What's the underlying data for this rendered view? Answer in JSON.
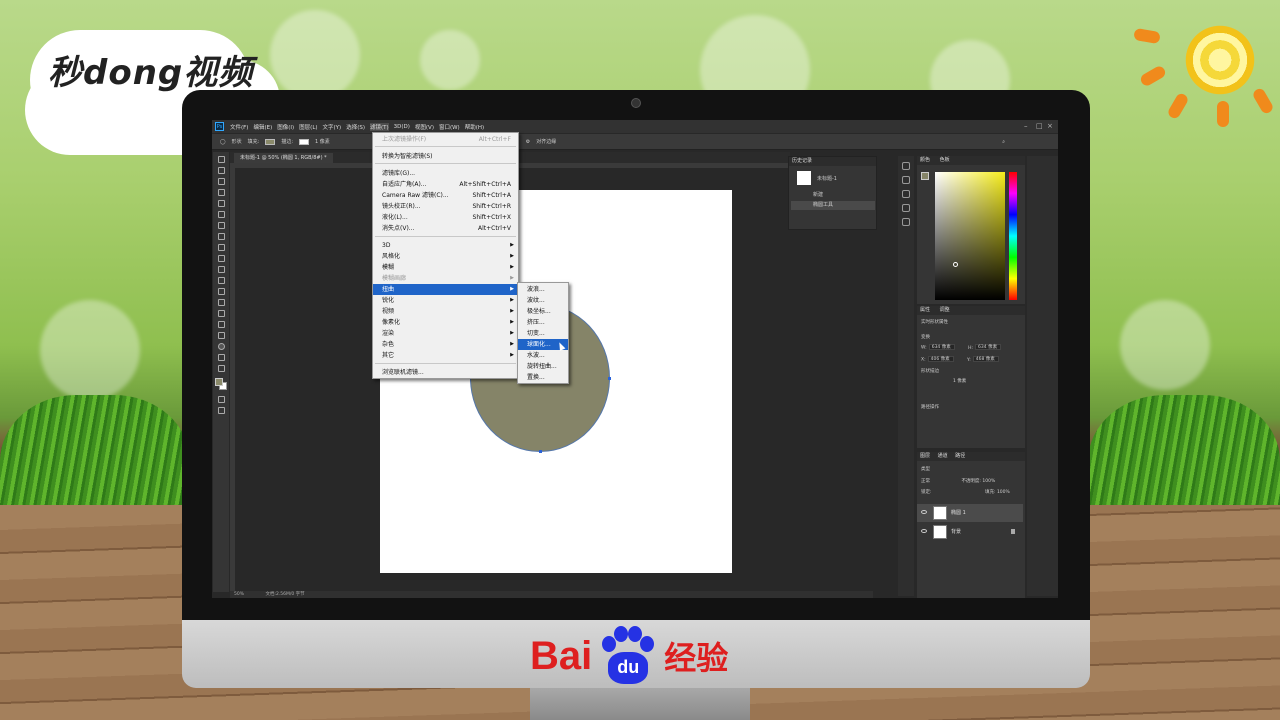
{
  "branding": {
    "logo_text": "秒dong视频",
    "baidu_bai": "Bai",
    "baidu_du": "du",
    "baidu_jingyan": "经验"
  },
  "photoshop": {
    "app_icon": "Ps",
    "menubar": [
      "文件(F)",
      "编辑(E)",
      "图像(I)",
      "图层(L)",
      "文字(Y)",
      "选择(S)",
      "滤镜(T)",
      "3D(D)",
      "视图(V)",
      "窗口(W)",
      "帮助(H)"
    ],
    "options": {
      "shape_mode": "形状",
      "fill_label": "填充:",
      "stroke_label": "描边:",
      "stroke_size": "1 像素",
      "align_edges": "对齐边缘"
    },
    "document_tab": "未标题-1 @ 50% (椭圆 1, RGB/8#) *",
    "status": "50%",
    "status_doc": "文档:2.56M/0 字节",
    "filter_menu": {
      "last_filter": "上次滤镜操作(F)",
      "last_filter_shortcut": "Alt+Ctrl+F",
      "smart": "转换为智能滤镜(S)",
      "gallery": "滤镜库(G)...",
      "adaptive_wide": "自适应广角(A)...",
      "adaptive_wide_shortcut": "Alt+Shift+Ctrl+A",
      "camera_raw": "Camera Raw 滤镜(C)...",
      "camera_raw_shortcut": "Shift+Ctrl+A",
      "lens": "镜头校正(R)...",
      "lens_shortcut": "Shift+Ctrl+R",
      "liquify": "液化(L)...",
      "liquify_shortcut": "Shift+Ctrl+X",
      "vanishing": "消失点(V)...",
      "vanishing_shortcut": "Alt+Ctrl+V",
      "groups": [
        "3D",
        "风格化",
        "模糊",
        "模糊画廊",
        "扭曲",
        "锐化",
        "视频",
        "像素化",
        "渲染",
        "杂色",
        "其它"
      ],
      "browse_online": "浏览联机滤镜..."
    },
    "distort_submenu": [
      "波浪...",
      "波纹...",
      "极坐标...",
      "挤压...",
      "切变...",
      "球面化...",
      "水波...",
      "旋转扭曲...",
      "置换..."
    ],
    "history": {
      "title": "历史记录",
      "snapshot": "未标题-1",
      "items": [
        "新建",
        "椭圆工具"
      ]
    },
    "color_panel": {
      "tab1": "颜色",
      "tab2": "色板"
    },
    "properties": {
      "tab1": "属性",
      "tab2": "调整",
      "kind": "实时形状属性",
      "section_transform": "变换",
      "w_label": "W:",
      "w_value": "634 像素",
      "h_label": "H:",
      "h_value": "634 像素",
      "x_label": "X:",
      "x_value": "406 像素",
      "y_label": "Y:",
      "y_value": "468 像素",
      "section_appearance": "形状描边",
      "stroke_value": "1 像素",
      "section_pathops": "路径操作"
    },
    "layers": {
      "tab1": "图层",
      "tab2": "通道",
      "tab3": "路径",
      "kind_filter": "类型",
      "blend_mode": "正常",
      "opacity_label": "不透明度:",
      "opacity_value": "100%",
      "lock_label": "锁定:",
      "fill_label": "填充:",
      "fill_value": "100%",
      "items": [
        "椭圆 1",
        "背景"
      ]
    }
  },
  "colors": {
    "ellipse_fill": "#858468",
    "menu_highlight": "#1f64c8"
  }
}
